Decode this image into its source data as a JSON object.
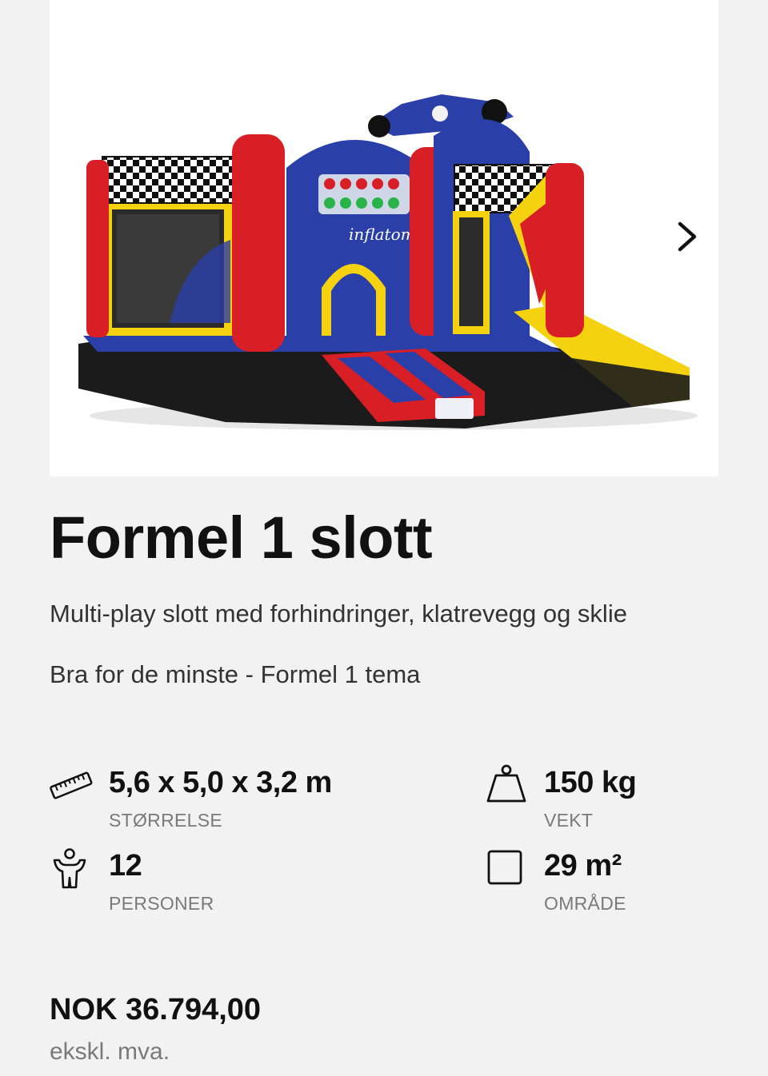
{
  "product": {
    "image_brand_text": "inflatom",
    "title": "Formel 1 slott",
    "description": [
      "Multi-play slott med forhindringer, klatrevegg og sklie",
      "Bra for de minste - Formel 1 tema"
    ]
  },
  "gallery": {
    "next_icon": "chevron-right-icon"
  },
  "specs": {
    "size": {
      "value": "5,6 x 5,0 x 3,2 m",
      "label": "STØRRELSE",
      "icon": "ruler-icon"
    },
    "weight": {
      "value": "150 kg",
      "label": "VEKT",
      "icon": "weight-icon"
    },
    "people": {
      "value": "12",
      "label": "PERSONER",
      "icon": "person-icon"
    },
    "area": {
      "value": "29 m²",
      "label": "OMRÅDE",
      "icon": "square-icon"
    }
  },
  "price": {
    "amount": "NOK 36.794,00",
    "vat_note": "ekskl. mva."
  },
  "colors": {
    "background": "#f2f2f2",
    "text": "#111111",
    "muted": "#7a7a7a"
  }
}
